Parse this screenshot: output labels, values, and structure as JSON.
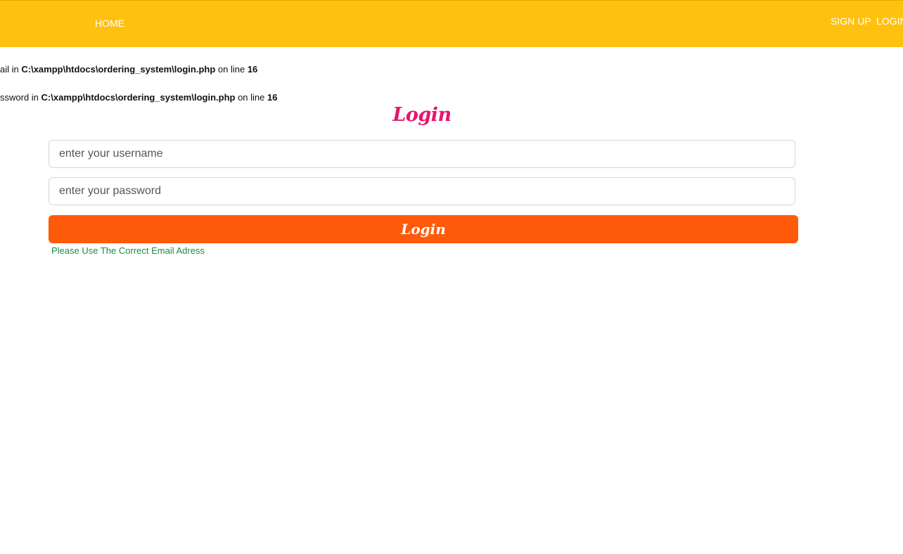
{
  "navbar": {
    "home_label": "HOME",
    "signup_label": "SIGN UP",
    "login_label": "LOGIN",
    "background_color": "#ffc10f"
  },
  "notices": [
    {
      "prefix": "ail in ",
      "path": "C:\\xampp\\htdocs\\ordering_system\\login.php",
      "middle": " on line ",
      "line": "16"
    },
    {
      "prefix": "ssword in ",
      "path": "C:\\xampp\\htdocs\\ordering_system\\login.php",
      "middle": " on line ",
      "line": "16"
    }
  ],
  "form": {
    "heading": "Login",
    "heading_color": "#e8136e",
    "username_placeholder": "enter your username",
    "password_placeholder": "enter your password",
    "submit_label": "Login",
    "submit_color": "#ff5a0a",
    "error_message": "Please Use The Correct Email Adress",
    "error_color": "#1a8a4a"
  }
}
